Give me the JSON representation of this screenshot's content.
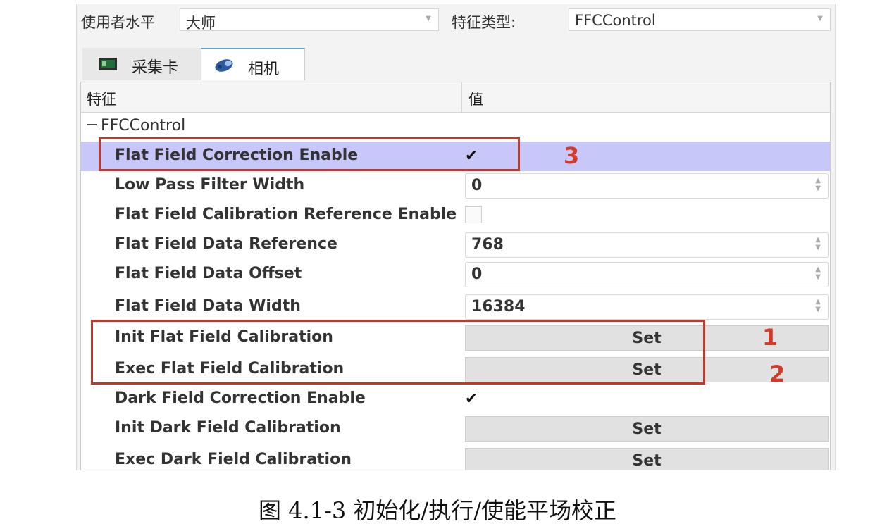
{
  "toolbar": {
    "user_level_label": "使用者水平",
    "user_level_value": "大师",
    "feature_type_label": "特征类型:",
    "feature_type_value": "FFCControl"
  },
  "tabs": [
    {
      "label": "采集卡",
      "icon": "capture-card-icon"
    },
    {
      "label": "相机",
      "icon": "camera-icon"
    }
  ],
  "table": {
    "col_feature": "特征",
    "col_value": "值",
    "group": "FFCControl",
    "rows": [
      {
        "name": "Flat Field Correction Enable",
        "type": "checkbox",
        "checked": true,
        "selected": true
      },
      {
        "name": "Low Pass Filter Width",
        "type": "spin",
        "value": "0"
      },
      {
        "name": "Flat Field Calibration Reference Enable",
        "type": "checkbox",
        "checked": false
      },
      {
        "name": "Flat Field Data Reference",
        "type": "spin",
        "value": "768"
      },
      {
        "name": "Flat Field Data Offset",
        "type": "spin",
        "value": "0"
      },
      {
        "name": "Flat Field Data Width",
        "type": "spin",
        "value": "16384"
      },
      {
        "name": "Init Flat Field Calibration",
        "type": "button",
        "value": "Set"
      },
      {
        "name": "Exec Flat Field Calibration",
        "type": "button",
        "value": "Set"
      },
      {
        "name": "Dark Field Correction Enable",
        "type": "checkbox",
        "checked": true
      },
      {
        "name": "Init Dark Field Calibration",
        "type": "button",
        "value": "Set"
      },
      {
        "name": "Exec Dark Field Calibration",
        "type": "button",
        "value": "Set"
      }
    ]
  },
  "annotations": [
    "1",
    "2",
    "3"
  ],
  "caption": "图 4.1-3  初始化/执行/使能平场校正",
  "colors": {
    "selected_row": "#c8c7fa",
    "annotation_red": "#c0392b"
  }
}
